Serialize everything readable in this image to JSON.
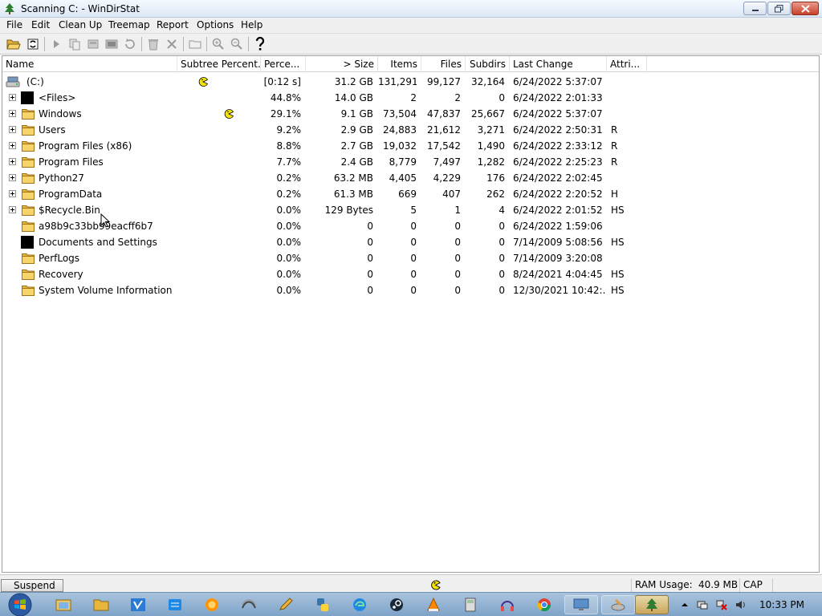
{
  "window": {
    "title": "Scanning C: - WinDirStat",
    "icon": "windirstat-tree-icon"
  },
  "menu": [
    "File",
    "Edit",
    "Clean Up",
    "Treemap",
    "Report",
    "Options",
    "Help"
  ],
  "toolbar": {
    "buttons": [
      "open-icon",
      "refresh-icon",
      "play-icon",
      "copy-icon",
      "clean-icon",
      "cmd-icon",
      "refresh-selected-icon",
      "recycle-icon",
      "delete-icon",
      "properties-icon",
      "zoom-in-icon",
      "zoom-out-icon",
      "help-icon"
    ]
  },
  "columns": {
    "name": "Name",
    "subtree": "Subtree Percent...",
    "percent": "Perce...",
    "size": "> Size",
    "items": "Items",
    "files": "Files",
    "subdirs": "Subdirs",
    "lastchange": "Last Change",
    "attributes": "Attri..."
  },
  "rows": [
    {
      "name": "(C:)",
      "percent": "[0:12 s]",
      "size": "31.2 GB",
      "items": "131,291",
      "files": "99,127",
      "subdirs": "32,164",
      "lastchange": "6/24/2022  5:37:07 ...",
      "attr": "",
      "icon": "drive-icon",
      "expander": false,
      "pacman": 0.28
    },
    {
      "name": "<Files>",
      "percent": "44.8%",
      "size": "14.0 GB",
      "items": "2",
      "files": "2",
      "subdirs": "0",
      "lastchange": "6/24/2022  2:01:33 ...",
      "attr": "",
      "icon": "files-icon",
      "expander": true,
      "pacman": null
    },
    {
      "name": "Windows",
      "percent": "29.1%",
      "size": "9.1 GB",
      "items": "73,504",
      "files": "47,837",
      "subdirs": "25,667",
      "lastchange": "6/24/2022  5:37:07 ...",
      "attr": "",
      "icon": "folder-icon",
      "expander": true,
      "pacman": 0.6
    },
    {
      "name": "Users",
      "percent": "9.2%",
      "size": "2.9 GB",
      "items": "24,883",
      "files": "21,612",
      "subdirs": "3,271",
      "lastchange": "6/24/2022  2:50:31 ...",
      "attr": "R",
      "icon": "folder-icon",
      "expander": true,
      "pacman": null
    },
    {
      "name": "Program Files (x86)",
      "percent": "8.8%",
      "size": "2.7 GB",
      "items": "19,032",
      "files": "17,542",
      "subdirs": "1,490",
      "lastchange": "6/24/2022  2:33:12 ...",
      "attr": "R",
      "icon": "folder-icon",
      "expander": true,
      "pacman": null
    },
    {
      "name": "Program Files",
      "percent": "7.7%",
      "size": "2.4 GB",
      "items": "8,779",
      "files": "7,497",
      "subdirs": "1,282",
      "lastchange": "6/24/2022  2:25:23 ...",
      "attr": "R",
      "icon": "folder-icon",
      "expander": true,
      "pacman": null
    },
    {
      "name": "Python27",
      "percent": "0.2%",
      "size": "63.2 MB",
      "items": "4,405",
      "files": "4,229",
      "subdirs": "176",
      "lastchange": "6/24/2022  2:02:45 ...",
      "attr": "",
      "icon": "folder-icon",
      "expander": true,
      "pacman": null
    },
    {
      "name": "ProgramData",
      "percent": "0.2%",
      "size": "61.3 MB",
      "items": "669",
      "files": "407",
      "subdirs": "262",
      "lastchange": "6/24/2022  2:20:52 ...",
      "attr": "H",
      "icon": "folder-icon",
      "expander": true,
      "pacman": null
    },
    {
      "name": "$Recycle.Bin",
      "percent": "0.0%",
      "size": "129 Bytes",
      "items": "5",
      "files": "1",
      "subdirs": "4",
      "lastchange": "6/24/2022  2:01:52 ...",
      "attr": "HS",
      "icon": "folder-icon",
      "expander": true,
      "pacman": null
    },
    {
      "name": "a98b9c33bb99eacff6b7",
      "percent": "0.0%",
      "size": "0",
      "items": "0",
      "files": "0",
      "subdirs": "0",
      "lastchange": "6/24/2022  1:59:06 ...",
      "attr": "",
      "icon": "folder-icon",
      "expander": false,
      "pacman": null
    },
    {
      "name": "Documents and Settings",
      "percent": "0.0%",
      "size": "0",
      "items": "0",
      "files": "0",
      "subdirs": "0",
      "lastchange": "7/14/2009  5:08:56 ...",
      "attr": "HS",
      "icon": "files-icon",
      "expander": false,
      "pacman": null
    },
    {
      "name": "PerfLogs",
      "percent": "0.0%",
      "size": "0",
      "items": "0",
      "files": "0",
      "subdirs": "0",
      "lastchange": "7/14/2009  3:20:08 ...",
      "attr": "",
      "icon": "folder-icon",
      "expander": false,
      "pacman": null
    },
    {
      "name": "Recovery",
      "percent": "0.0%",
      "size": "0",
      "items": "0",
      "files": "0",
      "subdirs": "0",
      "lastchange": "8/24/2021  4:04:45 ...",
      "attr": "HS",
      "icon": "folder-icon",
      "expander": false,
      "pacman": null
    },
    {
      "name": "System Volume Information",
      "percent": "0.0%",
      "size": "0",
      "items": "0",
      "files": "0",
      "subdirs": "0",
      "lastchange": "12/30/2021  10:42:...",
      "attr": "HS",
      "icon": "folder-icon",
      "expander": false,
      "pacman": null
    }
  ],
  "status": {
    "suspend": "Suspend",
    "ram_label": "RAM Usage:",
    "ram_value": "40.9 MB",
    "cap": "CAP"
  },
  "taskbar": {
    "icons": [
      "file-explorer-icon",
      "folder-icon",
      "vs-code-icon",
      "winstore-icon",
      "firefox-icon",
      "wireshark-icon",
      "pencil-icon",
      "python-icon",
      "edge-icon",
      "steam-icon",
      "vlc-icon",
      "calculator-icon",
      "headphones-icon",
      "chrome-icon",
      "remote-desktop-icon",
      "disk-cleanup-icon",
      "windirstat-icon"
    ],
    "clock": "10:33 PM"
  },
  "colors": {
    "pacman": "#f5e400",
    "folder": "#f2c94c",
    "taskbar": "#88abd0"
  }
}
